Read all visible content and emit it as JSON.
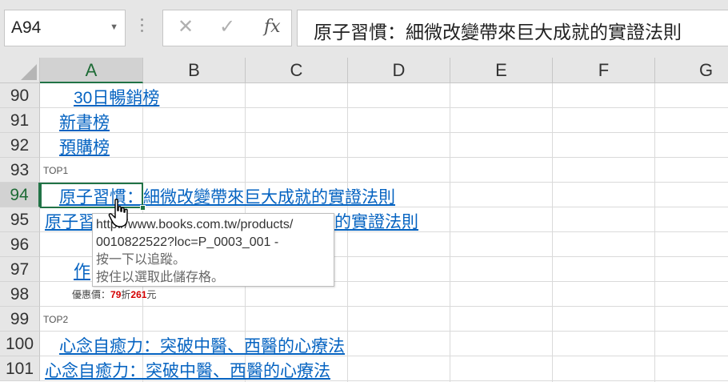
{
  "formula_bar": {
    "name_box": "A94",
    "cancel_icon": "x-icon",
    "enter_icon": "check-icon",
    "fx_label": "fx",
    "content": "原子習慣：細微改變帶來巨大成就的實證法則"
  },
  "columns": [
    "A",
    "B",
    "C",
    "D",
    "E",
    "F",
    "G"
  ],
  "selected_column": "A",
  "rows": [
    "90",
    "91",
    "92",
    "93",
    "94",
    "95",
    "96",
    "97",
    "98",
    "99",
    "100",
    "101"
  ],
  "selected_row": "94",
  "cells": {
    "r90": "30日暢銷榜",
    "r91": "新書榜",
    "r92": "預購榜",
    "r93": "TOP1",
    "r94": "原子習慣：細微改變帶來巨大成就的實證法則",
    "r95_left": "原子習",
    "r95_right": "的實證法則",
    "r97": "作",
    "r98_prefix": "優惠價：",
    "r98_discount": "79",
    "r98_mid": "折",
    "r98_price": "261",
    "r98_suffix": "元",
    "r99": "TOP2",
    "r100": "心念自癒力：突破中醫、西醫的心療法",
    "r101": "心念自癒力：突破中醫、西醫的心療法"
  },
  "tooltip": {
    "url_line1": "http://www.books.com.tw/products/",
    "url_line2": "0010822522?loc=P_0003_001 -",
    "hint1": "按一下以追蹤。",
    "hint2": "按住以選取此儲存格。"
  },
  "colors": {
    "link": "#0563c1",
    "select_green": "#217346",
    "price_red": "#d40000"
  }
}
